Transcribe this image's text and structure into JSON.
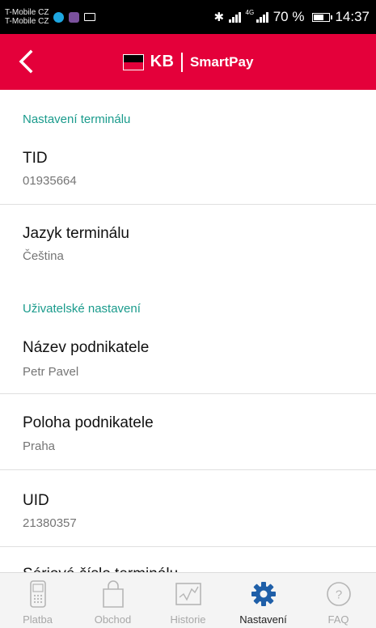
{
  "status_bar": {
    "carrier_1": "T-Mobile CZ",
    "carrier_2": "T-Mobile CZ",
    "network": "4G",
    "battery": "70 %",
    "battery_level": 0.7,
    "time": "14:37"
  },
  "header": {
    "logo_text": "KB",
    "app_name": "SmartPay",
    "brand_color": "#e4003a"
  },
  "sections": {
    "terminal": {
      "title": "Nastavení terminálu",
      "tid_label": "TID",
      "tid_value": "01935664",
      "lang_label": "Jazyk terminálu",
      "lang_value": "Čeština"
    },
    "user": {
      "title": "Uživatelské nastavení",
      "name_label": "Název podnikatele",
      "name_value": "Petr Pavel",
      "location_label": "Poloha podnikatele",
      "location_value": "Praha",
      "uid_label": "UID",
      "uid_value": "21380357",
      "serial_label": "Sériové číslo terminálu"
    }
  },
  "bottom_nav": {
    "tabs": [
      {
        "label": "Platba",
        "icon": "phone-terminal-icon",
        "active": false
      },
      {
        "label": "Obchod",
        "icon": "shopping-bag-icon",
        "active": false
      },
      {
        "label": "Historie",
        "icon": "chart-icon",
        "active": false
      },
      {
        "label": "Nastavení",
        "icon": "gear-icon",
        "active": true
      },
      {
        "label": "FAQ",
        "icon": "question-icon",
        "active": false
      }
    ],
    "active_color": "#1f5fa8"
  }
}
